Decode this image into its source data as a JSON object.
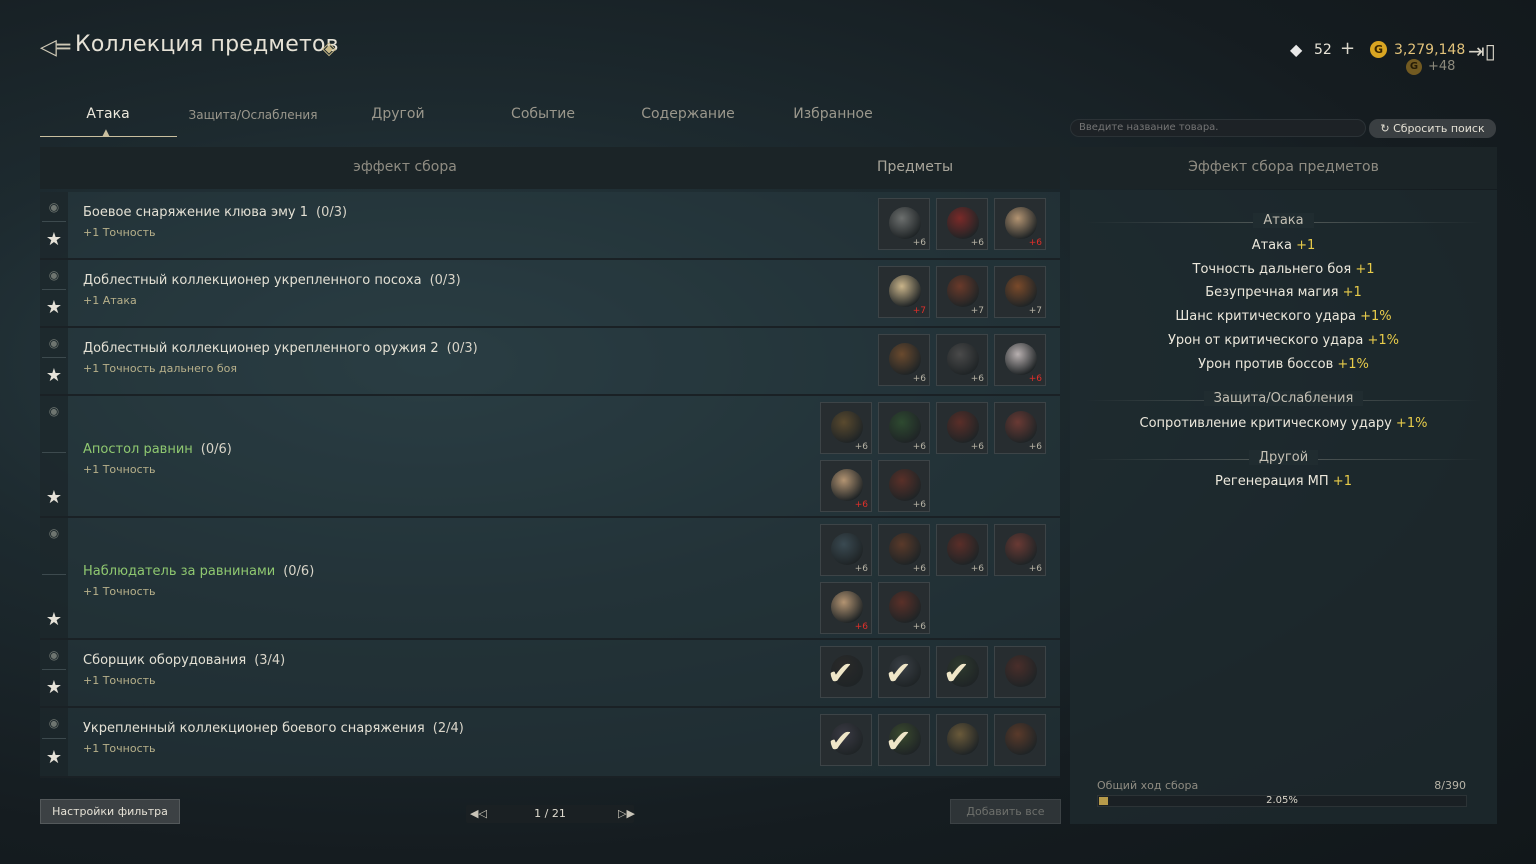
{
  "header": {
    "title": "Коллекция предметов",
    "diamonds": "52",
    "gold": "3,279,148",
    "gold_bonus": "+48",
    "plus_label": "+",
    "gold_symbol": "G"
  },
  "tabs": [
    "Атака",
    "Защита/Ослабления",
    "Другой",
    "Событие",
    "Содержание",
    "Избранное"
  ],
  "search": {
    "placeholder": "Введите название товара.",
    "reset_label": "Сбросить поиск"
  },
  "main": {
    "col_effect": "эффект сбора",
    "col_items": "Предметы"
  },
  "rows": [
    {
      "title": "Боевое снаряжение клюва эму 1",
      "count": "(0/3)",
      "bonus": "+1 Точность",
      "items": [
        {
          "lvl": "+6",
          "red": false,
          "color": "#6c6f6e"
        },
        {
          "lvl": "+6",
          "red": false,
          "color": "#7a2a28"
        },
        {
          "lvl": "+6",
          "red": true,
          "color": "#b39472"
        }
      ]
    },
    {
      "title": "Доблестный коллекционер укрепленного посоха",
      "count": "(0/3)",
      "bonus": "+1 Атака",
      "items": [
        {
          "lvl": "+7",
          "red": true,
          "color": "#c9b48a"
        },
        {
          "lvl": "+7",
          "red": false,
          "color": "#6a3a2a"
        },
        {
          "lvl": "+7",
          "red": false,
          "color": "#7a4a2a"
        }
      ]
    },
    {
      "title": "Доблестный коллекционер укрепленного оружия 2",
      "count": "(0/3)",
      "bonus": "+1 Точность дальнего боя",
      "items": [
        {
          "lvl": "+6",
          "red": false,
          "color": "#6a4a2e"
        },
        {
          "lvl": "+6",
          "red": false,
          "color": "#4a4a4a"
        },
        {
          "lvl": "+6",
          "red": true,
          "color": "#b8b0b0"
        }
      ]
    },
    {
      "title": "Апостол равнин",
      "count": "(0/6)",
      "bonus": "+1 Точность",
      "green": true,
      "items": [
        {
          "lvl": "+6",
          "red": false,
          "color": "#5a4a2e"
        },
        {
          "lvl": "+6",
          "red": false,
          "color": "#2e4a30"
        },
        {
          "lvl": "+6",
          "red": false,
          "color": "#5a2e28"
        },
        {
          "lvl": "+6",
          "red": false,
          "color": "#6a3a34"
        },
        {
          "lvl": "+6",
          "red": true,
          "color": "#b39472"
        },
        {
          "lvl": "+6",
          "red": false,
          "color": "#5a3028"
        }
      ]
    },
    {
      "title": "Наблюдатель за равнинами",
      "count": "(0/6)",
      "bonus": "+1 Точность",
      "green": true,
      "items": [
        {
          "lvl": "+6",
          "red": false,
          "color": "#3a4a52"
        },
        {
          "lvl": "+6",
          "red": false,
          "color": "#5a3a2a"
        },
        {
          "lvl": "+6",
          "red": false,
          "color": "#5a2e28"
        },
        {
          "lvl": "+6",
          "red": false,
          "color": "#6a3a34"
        },
        {
          "lvl": "+6",
          "red": true,
          "color": "#b39472"
        },
        {
          "lvl": "+6",
          "red": false,
          "color": "#5a3028"
        }
      ]
    },
    {
      "title": "Сборщик оборудования",
      "count": "(3/4)",
      "bonus": "+1 Точность",
      "items": [
        {
          "check": true,
          "color": "#2a2a2a"
        },
        {
          "check": true,
          "color": "#3a4046"
        },
        {
          "check": true,
          "color": "#2e3a2e"
        },
        {
          "lvl": "",
          "red": false,
          "color": "#4a2e2a"
        }
      ]
    },
    {
      "title": "Укрепленный коллекционер боевого снаряжения",
      "count": "(2/4)",
      "bonus": "+1 Точность",
      "items": [
        {
          "check": true,
          "color": "#3a3a44"
        },
        {
          "check": true,
          "color": "#3a4a2e"
        },
        {
          "lvl": "",
          "red": false,
          "color": "#6a5a3a"
        },
        {
          "lvl": "",
          "red": false,
          "color": "#5a3a2a"
        }
      ]
    }
  ],
  "effects": {
    "title": "Эффект сбора предметов",
    "groups": [
      {
        "name": "Атака",
        "stats": [
          {
            "label": "Атака",
            "value": "+1"
          },
          {
            "label": "Точность дальнего боя",
            "value": "+1"
          },
          {
            "label": "Безупречная магия",
            "value": "+1"
          },
          {
            "label": "Шанс критического удара",
            "value": "+1%"
          },
          {
            "label": "Урон от критического удара",
            "value": "+1%"
          },
          {
            "label": "Урон против боссов",
            "value": "+1%"
          }
        ]
      },
      {
        "name": "Защита/Ослабления",
        "stats": [
          {
            "label": "Сопротивление критическому удару",
            "value": "+1%"
          }
        ]
      },
      {
        "name": "Другой",
        "stats": [
          {
            "label": "Регенерация МП",
            "value": "+1"
          }
        ]
      }
    ]
  },
  "progress": {
    "label": "Общий ход сбора",
    "count": "8/390",
    "percent": "2.05%",
    "fraction": 0.0205
  },
  "footer": {
    "filter_label": "Настройки фильтра",
    "page": "1 / 21",
    "add_all_label": "Добавить все"
  },
  "icons": {
    "back": "back-arrow-icon",
    "title": "diamond-ornament-icon",
    "diamond": "diamond-icon",
    "gold": "gold-coin-icon",
    "exit": "exit-icon",
    "eye": "eye-icon",
    "star": "star-icon",
    "reset": "refresh-icon",
    "prev": "triangle-left-icon",
    "next": "triangle-right-icon"
  }
}
